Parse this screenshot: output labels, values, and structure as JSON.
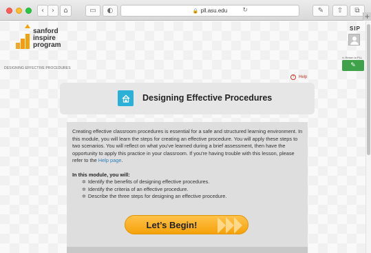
{
  "browser": {
    "url": "pll.asu.edu",
    "nav_back": "‹",
    "nav_forward": "›",
    "home_icon": "⌂",
    "sidebar_icon": "▭",
    "extension_icon": "◐",
    "reload_icon": "↻",
    "share_icon": "⇧",
    "tabs_icon": "⧉",
    "pen_icon": "✎",
    "new_tab": "+"
  },
  "header": {
    "logo_line1": "sanford",
    "logo_line2": "inspire",
    "logo_line3": "program",
    "user_initials": "SIP",
    "return_link": "⇐ Return to PLL",
    "edit_icon": "✎"
  },
  "breadcrumb": "DESIGNING EFFECTIVE PROCEDURES",
  "help": {
    "label": "Help",
    "icon": "?"
  },
  "module": {
    "title": "Designing Effective Procedures",
    "intro": "Creating effective classroom procedures is essential for a safe and structured learning environment. In this module, you will learn the steps for creating an effective procedure. You will apply these steps to two scenarios. You will reflect on what you've learned during a brief assessment, then have the opportunity to apply this practice in your classroom. If you're having trouble with this lesson, please refer to the ",
    "help_link": "Help page",
    "intro_end": ".",
    "objectives_heading": "In this module, you will:",
    "bullet": "✲",
    "objectives": [
      "Identify the benefits of designing effective procedures.",
      "Identify the criteria of an effective procedure.",
      "Describe the three steps for designing an effective procedure."
    ],
    "begin_label": "Let’s Begin!"
  },
  "colors": {
    "accent_orange": "#f5a20a",
    "icon_teal": "#2bb0d8",
    "edit_green": "#3fa24b",
    "help_red": "#c0392b"
  }
}
